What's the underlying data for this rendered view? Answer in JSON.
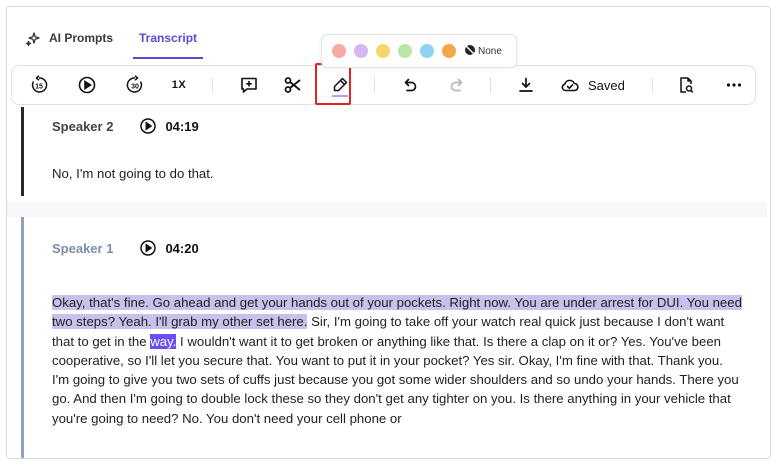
{
  "tabs": {
    "ai_prompts": "AI Prompts",
    "transcript": "Transcript"
  },
  "color_picker": {
    "colors": [
      "#f5a9a9",
      "#d4b8f2",
      "#f5d66b",
      "#b9e6a8",
      "#8fd3f0",
      "#f6a64a"
    ],
    "none_label": "None"
  },
  "toolbar": {
    "speed_label": "1X",
    "saved_label": "Saved",
    "rewind_label": "15",
    "forward_label": "30"
  },
  "transcript": {
    "segments": [
      {
        "speaker": "Speaker 2",
        "timestamp": "04:19",
        "text": "No, I'm not going to do that."
      },
      {
        "speaker": "Speaker 1",
        "timestamp": "04:20",
        "highlighted_text": "Okay, that's fine. Go ahead and get your hands out of your pockets. Right now. You are under arrest for DUI. You need two steps? Yeah. I'll grab my other set here.",
        "text_before_selection": " Sir, I'm going to take off your watch real quick just because I don't want that to get in the ",
        "selected_word": "way.",
        "text_after_selection": " I wouldn't want it to get broken or anything like that. Is there a clap on it or? Yes. You've been cooperative, so I'll let you secure that. You want to put it in your pocket? Yes sir. Okay, I'm fine with that. Thank you. I'm going to give you two sets of cuffs just because you got some wider shoulders and so undo your hands. There you go. And then I'm going to double lock these so they don't get any tighter on you. Is there anything in your vehicle that you're going to need? No. You don't need your cell phone or"
      }
    ]
  },
  "colors": {
    "accent": "#5b4ad6",
    "highlight": "#c9c0eb",
    "selection": "#6b4ff0",
    "active_tool_outline": "#e02424"
  }
}
